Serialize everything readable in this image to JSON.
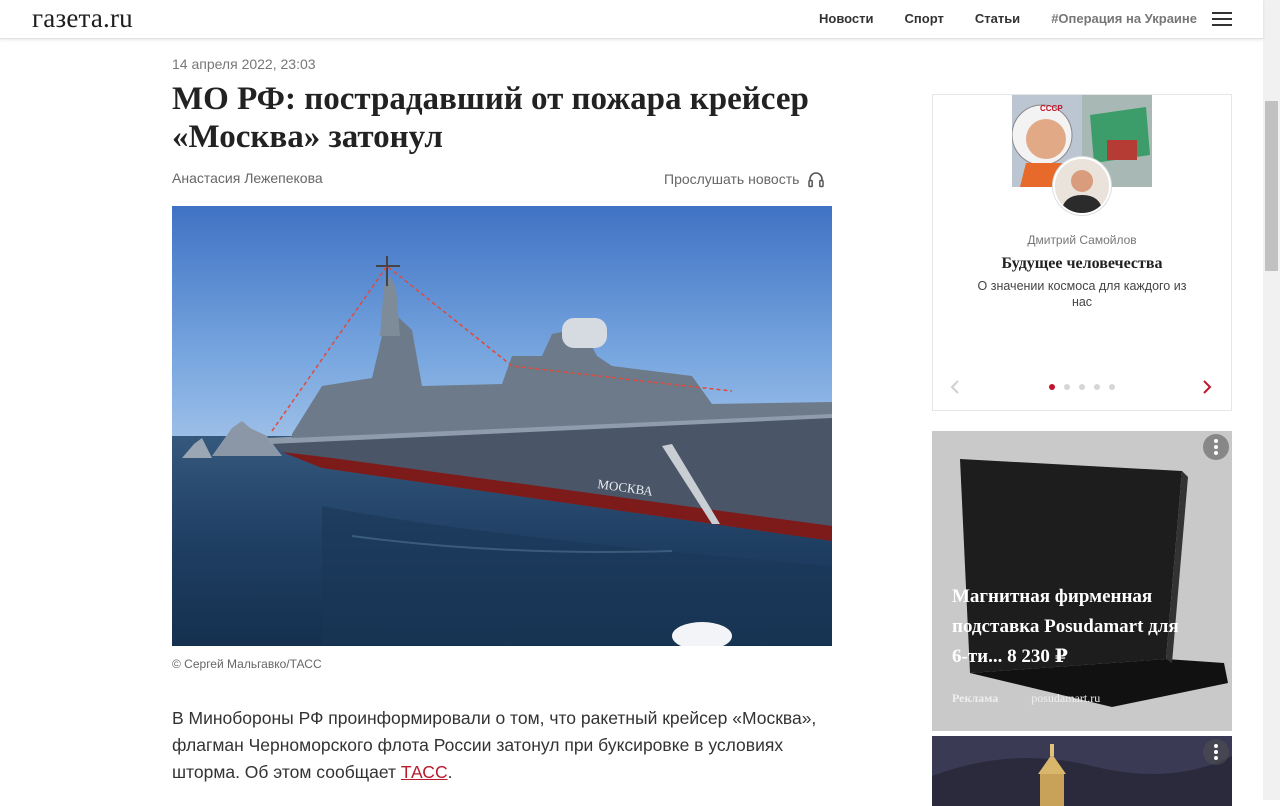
{
  "header": {
    "logo": "газета.ru",
    "nav": [
      "Новости",
      "Спорт",
      "Статьи",
      "#Операция на Украине"
    ],
    "menu_icon": "hamburger-icon"
  },
  "article": {
    "date": "14 апреля 2022, 23:03",
    "title": "МО РФ: пострадавший от пожара крейсер «Москва» затонул",
    "author": "Анастасия Лежепекова",
    "listen_label": "Прослушать новость",
    "listen_icon": "headphones-icon",
    "photo_ship_name": "МОСКВА",
    "caption": "©  Сергей Мальгавко/ТАСС",
    "body_before_link": "В Минобороны РФ проинформировали о том, что ракетный крейсер «Москва», флагман Черноморского флота России затонул при буксировке в условиях шторма. Об этом сообщает ",
    "body_link": "ТАСС",
    "body_after_link": "."
  },
  "carousel": {
    "author": "Дмитрий Самойлов",
    "title": "Будущее человечества",
    "subtitle": "О значении космоса для каждого из нас",
    "helmet_text": "СССР",
    "slides_count": 5,
    "active_slide": 0
  },
  "ad": {
    "text": "Магнитная фирменная подставка Posudamart для 6-ти... 8 230 ₽",
    "label": "Реклама",
    "domain": "posudamart.ru"
  },
  "colors": {
    "accent": "#c0152b",
    "link": "#b71c2c"
  }
}
